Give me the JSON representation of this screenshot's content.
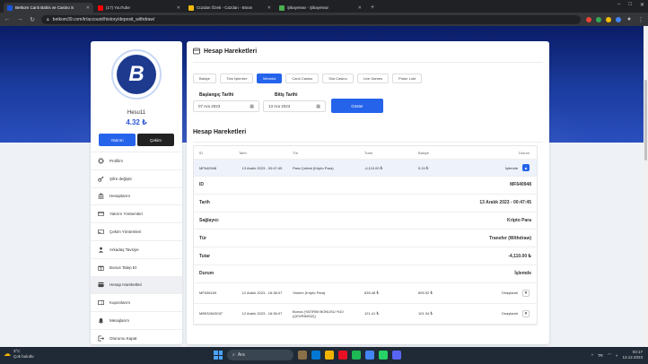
{
  "browser": {
    "tabs": [
      {
        "title": "Betkom Canlı Bahis ve Casino S",
        "color": "#1a56db",
        "active": true
      },
      {
        "title": "(17) YouTube",
        "color": "#ff0000",
        "active": false
      },
      {
        "title": "Cüzdan Özeti - Cüzdan - Binan",
        "color": "#f0b90b",
        "active": false
      },
      {
        "title": "Şikayetvar - Şikayetvar",
        "color": "#4caf50",
        "active": false
      }
    ],
    "new_tab": "+",
    "url": "betkom39.com/tr/account/history/deposit_withdraw/"
  },
  "user": {
    "avatar_letter": "B",
    "name": "Hesu11",
    "balance": "4.32 ₺",
    "deposit_label": "Yatırım",
    "withdraw_label": "Çekim"
  },
  "menu": [
    {
      "label": "Profilim",
      "icon": "gear-icon",
      "active": false
    },
    {
      "label": "Şifre değiştir",
      "icon": "key-icon",
      "active": false
    },
    {
      "label": "Hesaplarım",
      "icon": "bank-icon",
      "active": false
    },
    {
      "label": "Yatırım Yöntemleri",
      "icon": "deposit-icon",
      "active": false
    },
    {
      "label": "Çekim Yöntemleri",
      "icon": "withdraw-icon",
      "active": false
    },
    {
      "label": "Arkadaş Tavsiye",
      "icon": "referral-icon",
      "active": false
    },
    {
      "label": "Bonus Talep Et",
      "icon": "bonus-icon",
      "active": false
    },
    {
      "label": "Hesap Hareketleri",
      "icon": "transactions-icon",
      "active": true
    },
    {
      "label": "Kuponlarım",
      "icon": "coupon-icon",
      "active": false
    },
    {
      "label": "Mesajlarım",
      "icon": "bell-icon",
      "active": false
    },
    {
      "label": "Oturumu Kapat",
      "icon": "logout-icon",
      "active": false
    }
  ],
  "main": {
    "title": "Hesap Hareketleri",
    "filter_tabs": [
      {
        "label": "Bakiye",
        "active": false
      },
      {
        "label": "Tüm İşlemler",
        "active": false
      },
      {
        "label": "Ménnkd",
        "active": true
      },
      {
        "label": "Canlı Casino",
        "active": false
      },
      {
        "label": "Slot Casino",
        "active": false
      },
      {
        "label": "Live Games",
        "active": false
      },
      {
        "label": "Poker Lobi",
        "active": false
      }
    ],
    "start_label": "Başlangıç Tarihi",
    "start_value": "07 Ara 2023",
    "end_label": "Bitiş Tarihi",
    "end_value": "13 Ara 2023",
    "show_button": "Göster",
    "section_title": "Hesap Hareketleri",
    "table": {
      "headers": {
        "id": "ID",
        "date": "Tarih",
        "type": "Tür",
        "amount": "Tutar",
        "balance": "Bakiye",
        "status": "Durum"
      },
      "selected": {
        "id": "MF640948",
        "date": "13 Aralık 2023 - 00:47:45",
        "type": "Para Çekimi (Kripto Para)",
        "amount": "-4,110.00 ₺",
        "balance": "5.24 ₺",
        "status": "İşlemde"
      },
      "details": [
        {
          "label": "ID",
          "value": "MF640948"
        },
        {
          "label": "Tarih",
          "value": "13 Aralık 2023 - 00:47:45"
        },
        {
          "label": "Sağlayıcı",
          "value": "Kripto Para"
        },
        {
          "label": "Tür",
          "value": "Transfer (Withdraw)"
        },
        {
          "label": "Tutar",
          "value": "-4,110.00 ₺"
        },
        {
          "label": "Durum",
          "value": "İşlemde"
        }
      ],
      "rows": [
        {
          "id": "MF636169",
          "date": "12 Aralık 2023 - 16:38:07",
          "type": "Yatırım (Kripto Para)",
          "amount": "839.48 ₺",
          "balance": "895.92 ₺",
          "status": "Onaylandı"
        },
        {
          "id": "MB932843037",
          "date": "12 Aralık 2023 - 16:36:07",
          "type": "Bonus (YATIRIM BONUSU %10 (ÇEVRİMSİZ))",
          "amount": "121.41 ₺",
          "balance": "101.34 ₺",
          "status": "Onaylandı"
        }
      ]
    }
  },
  "taskbar": {
    "temp": "3°C",
    "weather_text": "Çok bulutlu",
    "search_label": "Ara",
    "lang": "TR",
    "time": "03:17",
    "date": "13.12.2023"
  }
}
